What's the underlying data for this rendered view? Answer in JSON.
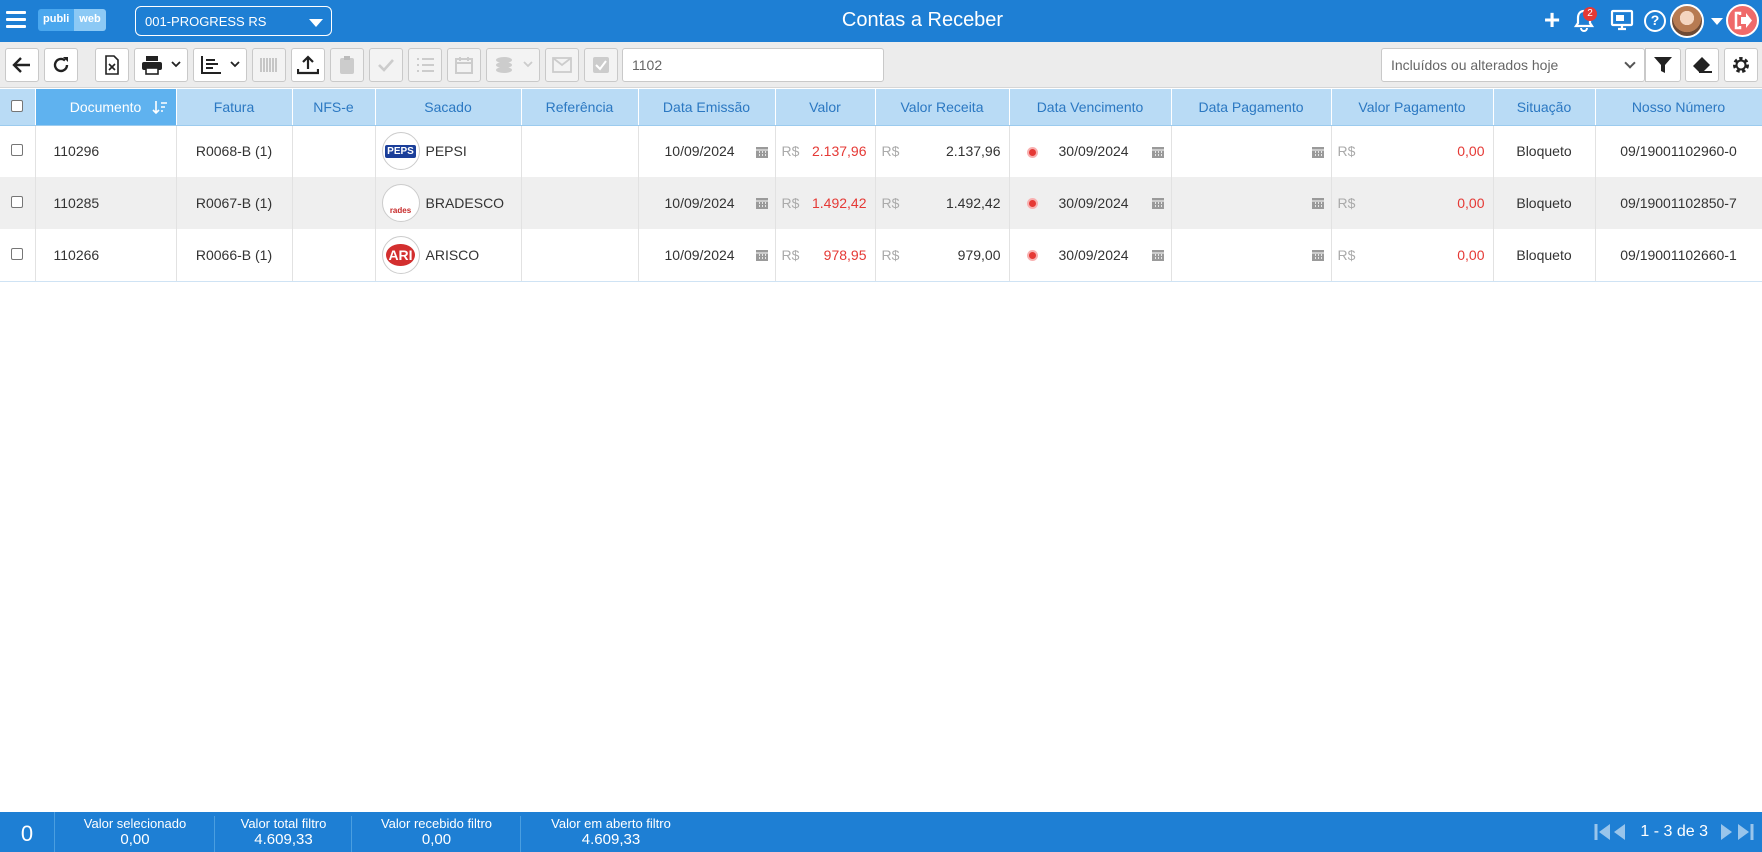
{
  "header": {
    "logo_left": "publi",
    "logo_right": "web",
    "company": "001-PROGRESS RS",
    "title": "Contas a Receber",
    "notifications_count": "2",
    "help_label": "?"
  },
  "toolbar": {
    "search_value": "1102",
    "filter_selected": "Incluídos ou alterados hoje"
  },
  "table": {
    "columns": [
      "Documento",
      "Fatura",
      "NFS-e",
      "Sacado",
      "Referência",
      "Data Emissão",
      "Valor",
      "Valor Receita",
      "Data Vencimento",
      "Data Pagamento",
      "Valor Pagamento",
      "Situação",
      "Nosso Número"
    ],
    "currency": "R$",
    "rows": [
      {
        "documento": "110296",
        "fatura": "R0068-B (1)",
        "nfse": "",
        "sacado": "PEPSI",
        "logo": "PEPS",
        "referencia": "",
        "emissao": "10/09/2024",
        "valor": "2.137,96",
        "receita": "2.137,96",
        "vencimento": "30/09/2024",
        "pagamento": "",
        "valor_pagamento": "0,00",
        "situacao": "Bloqueto",
        "nosso_numero": "09/19001102960-0"
      },
      {
        "documento": "110285",
        "fatura": "R0067-B (1)",
        "nfse": "",
        "sacado": "BRADESCO",
        "logo": "rades",
        "referencia": "",
        "emissao": "10/09/2024",
        "valor": "1.492,42",
        "receita": "1.492,42",
        "vencimento": "30/09/2024",
        "pagamento": "",
        "valor_pagamento": "0,00",
        "situacao": "Bloqueto",
        "nosso_numero": "09/19001102850-7"
      },
      {
        "documento": "110266",
        "fatura": "R0066-B (1)",
        "nfse": "",
        "sacado": "ARISCO",
        "logo": "ARI",
        "referencia": "",
        "emissao": "10/09/2024",
        "valor": "978,95",
        "receita": "979,00",
        "vencimento": "30/09/2024",
        "pagamento": "",
        "valor_pagamento": "0,00",
        "situacao": "Bloqueto",
        "nosso_numero": "09/19001102660-1"
      }
    ]
  },
  "footer": {
    "selected_count": "0",
    "valor_selecionado_label": "Valor selecionado",
    "valor_selecionado": "0,00",
    "valor_total_label": "Valor total filtro",
    "valor_total": "4.609,33",
    "valor_recebido_label": "Valor recebido filtro",
    "valor_recebido": "0,00",
    "valor_aberto_label": "Valor em aberto filtro",
    "valor_aberto": "4.609,33",
    "pagination": "1 - 3 de 3"
  },
  "colors": {
    "primary": "#1e7fd4",
    "header_row": "#b9dbf5",
    "active_column": "#5fb2ef",
    "negative": "#e53935"
  }
}
